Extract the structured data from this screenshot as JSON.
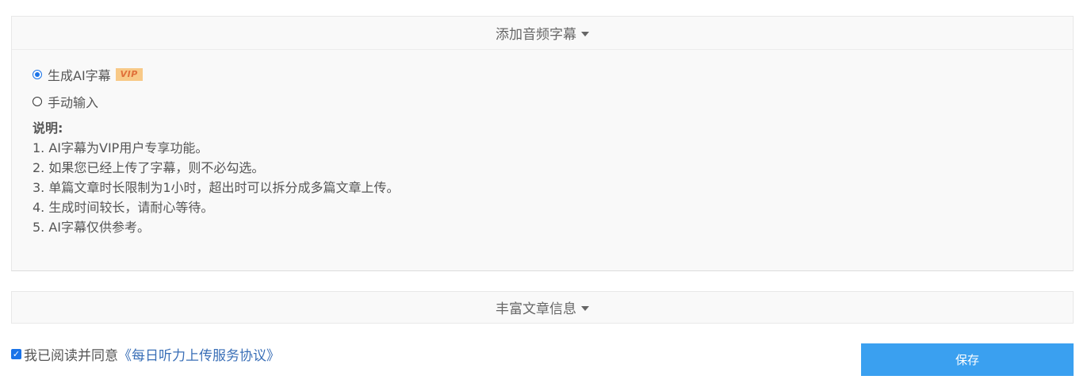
{
  "subtitle_panel": {
    "header": "添加音频字幕",
    "options": [
      {
        "label": "生成AI字幕",
        "badge": "VIP",
        "selected": true
      },
      {
        "label": "手动输入",
        "selected": false
      }
    ],
    "notes_title": "说明:",
    "notes": [
      "1. AI字幕为VIP用户专享功能。",
      "2. 如果您已经上传了字幕，则不必勾选。",
      "3. 单篇文章时长限制为1小时，超出时可以拆分成多篇文章上传。",
      "4. 生成时间较长，请耐心等待。",
      "5. AI字幕仅供参考。"
    ]
  },
  "enrich_panel": {
    "header": "丰富文章信息"
  },
  "agreement": {
    "checked": true,
    "text": "我已阅读并同意",
    "link": "《每日听力上传服务协议》"
  },
  "save_label": "保存",
  "colors": {
    "accent": "#1a73e8",
    "button": "#3aa0f0",
    "vip_bg": "#f8c987",
    "vip_text": "#e0703a",
    "link": "#3a6fb7"
  },
  "icons": {
    "header_toggle": "caret-down-icon"
  }
}
